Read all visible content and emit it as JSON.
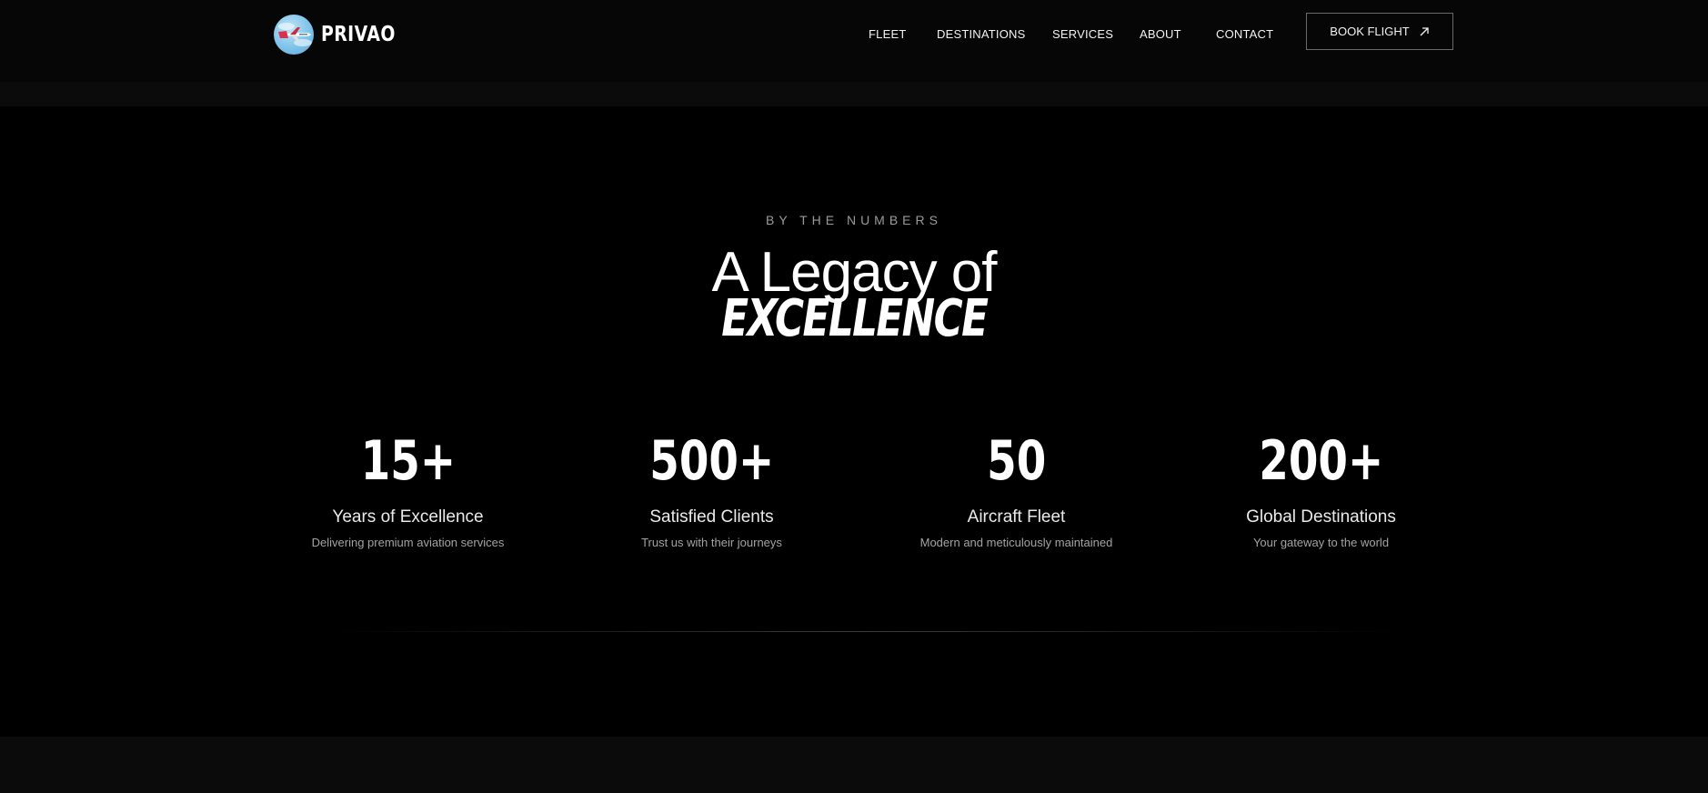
{
  "brand": {
    "name": "PRIVAO"
  },
  "nav": {
    "items": [
      {
        "label": "FLEET"
      },
      {
        "label": "DESTINATIONS"
      },
      {
        "label": "SERVICES"
      },
      {
        "label": "ABOUT"
      },
      {
        "label": "CONTACT"
      }
    ],
    "cta_label": "BOOK FLIGHT"
  },
  "section": {
    "eyebrow": "BY THE NUMBERS",
    "title_line1": "A Legacy of",
    "title_line2": "EXCELLENCE"
  },
  "stats": [
    {
      "value": "15+",
      "label": "Years of Excellence",
      "desc": "Delivering premium aviation services"
    },
    {
      "value": "500+",
      "label": "Satisfied Clients",
      "desc": "Trust us with their journeys"
    },
    {
      "value": "50",
      "label": "Aircraft Fleet",
      "desc": "Modern and meticulously maintained"
    },
    {
      "value": "200+",
      "label": "Global Destinations",
      "desc": "Your gateway to the world"
    }
  ],
  "colors": {
    "background": "#000000",
    "header": "#060606",
    "muted_text": "#a3a3a3"
  },
  "icons": {
    "logo": "airplane-logo-icon",
    "cta": "arrow-up-right-icon"
  }
}
